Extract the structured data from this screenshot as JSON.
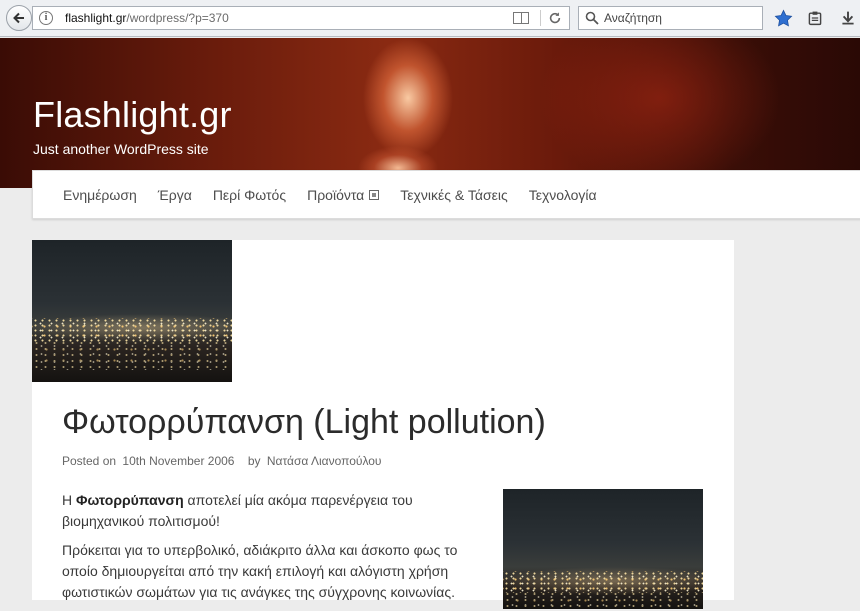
{
  "browser": {
    "url_domain": "flashlight.gr",
    "url_path": "/wordpress/?p=370",
    "search_placeholder": "Αναζήτηση",
    "icons": [
      "back-arrow-icon",
      "info-icon",
      "reader-view-icon",
      "reload-icon",
      "search-icon",
      "bookmark-star-icon",
      "clipboard-icon",
      "download-icon"
    ]
  },
  "site": {
    "title": "Flashlight.gr",
    "description": "Just another WordPress site"
  },
  "nav": {
    "items": [
      {
        "label": "Ενημέρωση"
      },
      {
        "label": "Έργα"
      },
      {
        "label": "Περί Φωτός"
      },
      {
        "label": "Προϊόντα"
      },
      {
        "label": "Τεχνικές & Τάσεις"
      },
      {
        "label": "Τεχνολογία"
      }
    ]
  },
  "post": {
    "title": "Φωτορρύπανση (Light pollution)",
    "meta_posted": "Posted on",
    "meta_date": "10th November 2006",
    "meta_by": "by",
    "meta_author": "Νατάσα Λιανοπούλου",
    "p1_lead": "Η ",
    "p1_bold": "Φωτορρύπανση",
    "p1_rest": " αποτελεί μία ακόμα παρενέργεια του βιομηχανικού πολιτισμού!",
    "p2": "Πρόκειται για το υπερβολικό, αδιάκριτο άλλα και άσκοπο φως το οποίο δημιουργείται από την κακή επιλογή και αλόγιστη χρήση φωτιστικών σωμάτων για τις ανάγκες της σύγχρονης κοινωνίας."
  },
  "colors": {
    "bookmark_star": "#2f6fd0",
    "banner_dark": "#3a0c05",
    "banner_light": "#ffd2aa"
  }
}
